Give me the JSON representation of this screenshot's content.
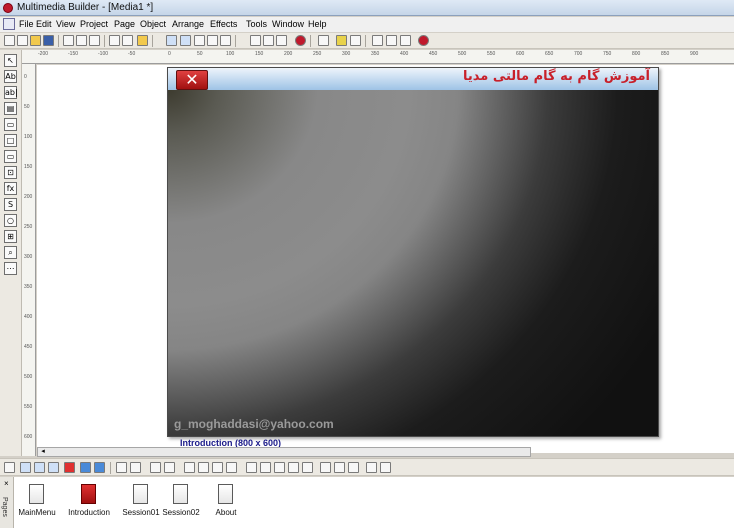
{
  "window": {
    "title": "Multimedia Builder - [Media1 *]"
  },
  "menu": [
    "File",
    "Edit",
    "View",
    "Project",
    "Page",
    "Object",
    "Arrange",
    "Effects",
    "Tools",
    "Window",
    "Help"
  ],
  "ruler": {
    "horizontal_ticks": [
      "-200",
      "-150",
      "-100",
      "-50",
      "0",
      "50",
      "100",
      "150",
      "200",
      "250",
      "300",
      "350",
      "400",
      "450",
      "500",
      "550",
      "600",
      "650",
      "700",
      "750",
      "800",
      "850",
      "900"
    ],
    "vertical_ticks": [
      "0",
      "50",
      "100",
      "150",
      "200",
      "250",
      "300",
      "350",
      "400",
      "450",
      "500",
      "550",
      "600"
    ]
  },
  "page": {
    "header_title": "آموزش گام به گام مالتی مدیا",
    "close_glyph": "✕",
    "email": "g_moghaddasi@yahoo.com",
    "label": "Introduction (800 x 600)"
  },
  "left_tools": [
    "↖",
    "Ab",
    "ab|",
    "▤",
    "▭",
    "□",
    "▭",
    "⊡",
    "fx",
    "S",
    "○",
    "⊞",
    "⌕",
    "⋯"
  ],
  "pages_panel": {
    "tab_label": "Pages",
    "close_glyph": "×",
    "pages": [
      "MainMenu",
      "Introduction",
      "Session01",
      "Session02",
      "About"
    ]
  },
  "colors": {
    "accent_title": "#c8202a",
    "close_button": "#c41e1e",
    "page_label": "#1a1a8a"
  }
}
